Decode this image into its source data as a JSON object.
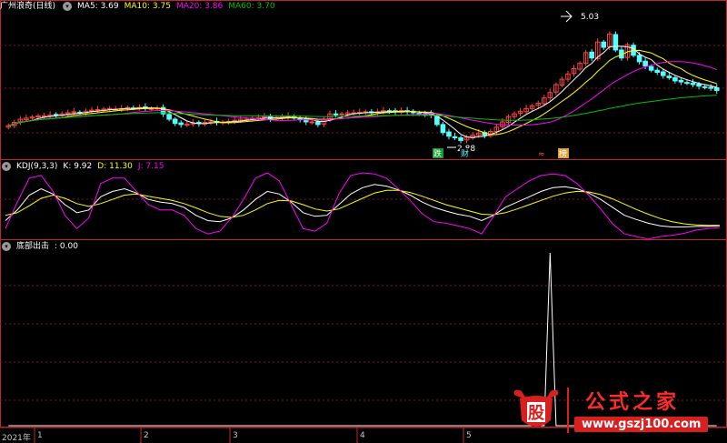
{
  "colors": {
    "background": "#000000",
    "frame": "#c0272d",
    "grid": "#7a1a1a",
    "up": "#ff4242",
    "down": "#54ffff",
    "ma5": "#ffffff",
    "ma10": "#ffff00",
    "ma20": "#ff00ff",
    "ma60": "#00c000",
    "k": "#ffffff",
    "d": "#ffff00",
    "j": "#ff00ff"
  },
  "price_panel": {
    "title": "广州浪奇(日线)",
    "ma5": "MA5: 3.69",
    "ma10": "MA10: 3.75",
    "ma20": "MA20: 3.86",
    "ma60": "MA60: 3.70",
    "high_marker": "5.03",
    "low_marker": "2.88",
    "event_tags": [
      "跌",
      "财",
      "≈",
      "榜"
    ]
  },
  "kdj_panel": {
    "title": "KDJ(9,3,3)",
    "k": "K: 9.92",
    "d": "D: 11.30",
    "j": "J: 7.15"
  },
  "signal_panel": {
    "title": "底部出击",
    "value": ": 0.00"
  },
  "time_axis": {
    "labels": [
      "2021年",
      "1",
      "2",
      "3",
      "4",
      "5"
    ]
  },
  "watermark": {
    "title": "公式之家",
    "url": "www.gszj100.com",
    "badge_text": "股"
  },
  "chart_data": [
    {
      "type": "candlestick",
      "title": "广州浪奇(日线)",
      "xlabel": "",
      "ylabel": "",
      "ylim": [
        2.6,
        5.3
      ],
      "x": [
        1,
        2,
        3,
        4,
        5,
        6,
        7,
        8,
        9,
        10,
        11,
        12,
        13,
        14,
        15,
        16,
        17,
        18,
        19,
        20,
        21,
        22,
        23,
        24,
        25,
        26,
        27,
        28,
        29,
        30,
        31,
        32,
        33,
        34,
        35,
        36,
        37,
        38,
        39,
        40,
        41,
        42,
        43,
        44,
        45,
        46,
        47,
        48,
        49,
        50,
        51,
        52,
        53,
        54,
        55,
        56,
        57,
        58,
        59,
        60,
        61,
        62,
        63,
        64,
        65,
        66,
        67,
        68,
        69,
        70,
        71,
        72,
        73,
        74,
        75,
        76,
        77,
        78,
        79,
        80,
        81,
        82,
        83,
        84,
        85,
        86,
        87,
        88,
        89,
        90,
        91,
        92,
        93,
        94,
        95,
        96,
        97,
        98,
        99,
        100,
        101,
        102,
        103,
        104,
        105,
        106,
        107,
        108,
        109,
        110,
        111,
        112,
        113,
        114,
        115,
        116,
        117,
        118,
        119,
        120
      ],
      "close": [
        3.18,
        3.24,
        3.3,
        3.32,
        3.34,
        3.36,
        3.36,
        3.38,
        3.38,
        3.4,
        3.42,
        3.44,
        3.42,
        3.45,
        3.47,
        3.48,
        3.49,
        3.5,
        3.49,
        3.5,
        3.52,
        3.51,
        3.52,
        3.51,
        3.5,
        3.51,
        3.4,
        3.3,
        3.22,
        3.2,
        3.21,
        3.23,
        3.22,
        3.24,
        3.25,
        3.24,
        3.25,
        3.26,
        3.28,
        3.3,
        3.3,
        3.32,
        3.33,
        3.35,
        3.31,
        3.33,
        3.34,
        3.36,
        3.32,
        3.29,
        3.25,
        3.25,
        3.2,
        3.3,
        3.4,
        3.38,
        3.4,
        3.42,
        3.42,
        3.43,
        3.44,
        3.42,
        3.44,
        3.46,
        3.45,
        3.44,
        3.46,
        3.44,
        3.42,
        3.4,
        3.39,
        3.38,
        3.2,
        3.05,
        2.98,
        2.95,
        2.9,
        2.96,
        3.0,
        3.04,
        3.0,
        3.07,
        3.15,
        3.25,
        3.35,
        3.4,
        3.45,
        3.5,
        3.55,
        3.6,
        3.7,
        3.8,
        3.95,
        4.05,
        4.15,
        4.25,
        4.35,
        4.55,
        4.45,
        4.75,
        4.65,
        4.9,
        4.6,
        4.45,
        4.7,
        4.5,
        4.38,
        4.3,
        4.22,
        4.18,
        4.12,
        4.08,
        4.02,
        4.0,
        3.98,
        3.95,
        3.92,
        3.9,
        3.88,
        3.84
      ],
      "ma_labels": [
        "MA5: 3.69",
        "MA10: 3.75",
        "MA20: 3.86",
        "MA60: 3.70"
      ],
      "annotations": [
        "5.03",
        "2.88"
      ]
    },
    {
      "type": "line",
      "title": "KDJ(9,3,3)",
      "xlabel": "",
      "ylabel": "",
      "ylim": [
        -10,
        110
      ],
      "series": [
        {
          "name": "K",
          "values": [
            20,
            40,
            68,
            80,
            70,
            50,
            35,
            40,
            65,
            75,
            80,
            72,
            60,
            55,
            52,
            45,
            30,
            20,
            18,
            25,
            40,
            60,
            75,
            70,
            55,
            35,
            28,
            30,
            50,
            70,
            82,
            88,
            85,
            78,
            68,
            55,
            45,
            38,
            32,
            28,
            20,
            30,
            45,
            55,
            65,
            75,
            82,
            84,
            80,
            72,
            60,
            45,
            30,
            22,
            15,
            10,
            8,
            8,
            9,
            9,
            10
          ]
        },
        {
          "name": "D",
          "values": [
            30,
            35,
            48,
            62,
            68,
            62,
            52,
            47,
            52,
            60,
            68,
            70,
            66,
            62,
            58,
            52,
            44,
            35,
            28,
            26,
            30,
            40,
            52,
            58,
            57,
            50,
            42,
            38,
            42,
            52,
            62,
            72,
            77,
            77,
            73,
            66,
            58,
            50,
            44,
            38,
            32,
            31,
            35,
            42,
            50,
            58,
            66,
            72,
            75,
            74,
            69,
            61,
            51,
            41,
            32,
            24,
            18,
            14,
            12,
            11,
            11
          ]
        },
        {
          "name": "J",
          "values": [
            5,
            55,
            100,
            105,
            75,
            30,
            5,
            25,
            90,
            100,
            100,
            75,
            50,
            40,
            40,
            30,
            5,
            -5,
            0,
            25,
            60,
            100,
            110,
            95,
            50,
            5,
            0,
            15,
            70,
            105,
            110,
            108,
            100,
            80,
            58,
            33,
            18,
            15,
            10,
            5,
            -5,
            28,
            65,
            80,
            95,
            105,
            108,
            105,
            90,
            68,
            42,
            14,
            -5,
            -10,
            -15,
            -10,
            -8,
            -4,
            2,
            5,
            7
          ]
        }
      ],
      "ylabel_values": [
        "K: 9.92",
        "D: 11.30",
        "J: 7.15"
      ]
    },
    {
      "type": "line",
      "title": "底部出击",
      "xlabel": "",
      "ylabel": "",
      "ylim": [
        0,
        100
      ],
      "series": [
        {
          "name": "底部出击",
          "values": [
            0,
            0,
            0,
            0,
            0,
            0,
            0,
            0,
            0,
            0,
            0,
            0,
            0,
            0,
            0,
            0,
            0,
            0,
            0,
            0,
            0,
            0,
            0,
            0,
            0,
            0,
            0,
            0,
            0,
            0,
            0,
            0,
            0,
            0,
            0,
            0,
            0,
            0,
            0,
            0,
            0,
            0,
            0,
            0,
            0,
            0,
            0,
            0,
            0,
            0,
            0,
            0,
            0,
            0,
            0,
            0,
            0,
            0,
            0,
            0,
            0,
            0,
            0,
            0,
            0,
            0,
            0,
            0,
            0,
            0,
            0,
            0,
            0,
            0,
            0,
            0,
            0,
            0,
            0,
            0,
            0,
            0,
            0,
            0,
            0,
            0,
            0,
            0,
            0,
            0,
            0,
            100,
            0,
            0,
            0,
            0,
            0,
            0,
            0,
            0,
            0,
            0,
            0,
            0,
            0,
            0,
            0,
            0,
            0,
            0,
            0,
            0,
            0,
            0,
            0,
            0,
            0,
            0,
            0,
            0
          ]
        }
      ]
    }
  ]
}
